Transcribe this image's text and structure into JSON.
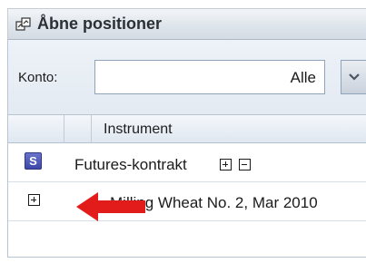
{
  "window": {
    "title": "Åbne positioner",
    "title_icon": "positions-window-icon"
  },
  "filter": {
    "konto_label": "Konto:",
    "konto_value": "Alle",
    "dropdown_icon": "chevron-down-icon"
  },
  "grid": {
    "columns": [
      "",
      "",
      "Instrument"
    ],
    "group_row": {
      "icon_letter": "S",
      "label": "Futures-kontrakt",
      "expand_icon": "plus-box-icon",
      "collapse_icon": "minus-box-icon"
    },
    "item_row": {
      "expand_icon": "plus-box-icon",
      "label": "Milling Wheat No. 2, Mar 2010"
    }
  },
  "annotation": {
    "arrow_color": "#e21b1b",
    "arrow_icon": "red-arrow-left-icon"
  }
}
